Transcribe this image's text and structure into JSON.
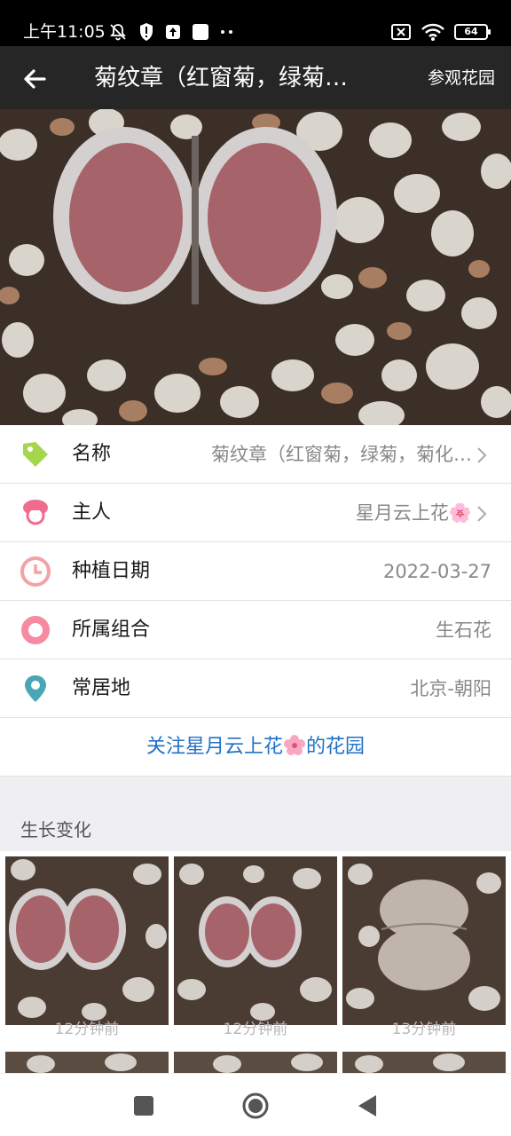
{
  "status_bar": {
    "time": "上午11:05",
    "battery": "64",
    "icons": [
      "mute-bell-icon",
      "alert-shield-icon",
      "upload-icon",
      "square-notification-icon",
      "more-dots-icon",
      "no-sim-icon",
      "wifi-icon",
      "battery-icon"
    ]
  },
  "app_bar": {
    "back_icon": "arrow-left-icon",
    "title": "菊纹章（红窗菊，绿菊…",
    "action": "参观花园"
  },
  "info": {
    "rows": [
      {
        "icon": "tag-icon",
        "label": "名称",
        "value": "菊纹章（红窗菊，绿菊，菊化…",
        "arrow": true,
        "color": "#a6d64d"
      },
      {
        "icon": "person-icon",
        "label": "主人",
        "value": "星月云上花🌸",
        "arrow": true,
        "color": "#f06c8f"
      },
      {
        "icon": "clock-icon",
        "label": "种植日期",
        "value": "2022-03-27",
        "arrow": false,
        "color": "#f2a3a3"
      },
      {
        "icon": "ring-icon",
        "label": "所属组合",
        "value": "生石花",
        "arrow": false,
        "color": "#f58aa0"
      },
      {
        "icon": "location-pin-icon",
        "label": "常居地",
        "value": "北京-朝阳",
        "arrow": false,
        "color": "#4aa6b5"
      }
    ],
    "follow_prefix": "关注星月云上花",
    "follow_suffix": "的花园"
  },
  "growth": {
    "title": "生长变化",
    "items": [
      {
        "time": "12分钟前"
      },
      {
        "time": "12分钟前"
      },
      {
        "time": "13分钟前"
      }
    ]
  },
  "nav": {
    "icons": [
      "square-recents-icon",
      "circle-home-icon",
      "triangle-back-icon"
    ]
  },
  "colors": {
    "app_bar_bg": "#262626",
    "link": "#1f72c8",
    "section_bg": "#efeff2"
  }
}
